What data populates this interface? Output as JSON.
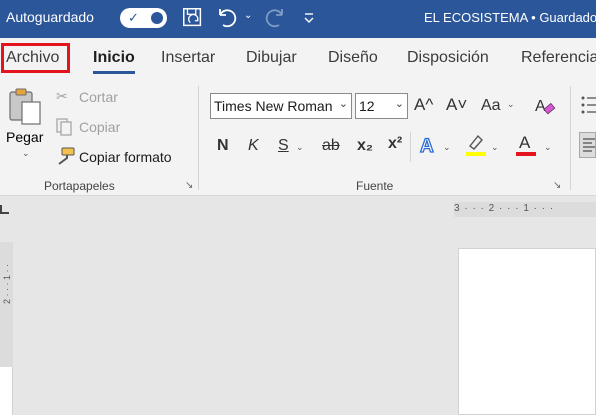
{
  "titlebar": {
    "autosave_label": "Autoguardado",
    "autosave_state": "on",
    "qat_icons": [
      "save-sync-icon",
      "undo-icon",
      "redo-icon",
      "customize-qat-icon"
    ],
    "document_title": "EL ECOSISTEMA • Guardado"
  },
  "tabs": [
    {
      "label": "Archivo",
      "highlighted": true
    },
    {
      "label": "Inicio",
      "active": true
    },
    {
      "label": "Insertar"
    },
    {
      "label": "Dibujar"
    },
    {
      "label": "Diseño"
    },
    {
      "label": "Disposición"
    },
    {
      "label": "Referencias"
    }
  ],
  "clipboard": {
    "paste_label": "Pegar",
    "cut_label": "Cortar",
    "copy_label": "Copiar",
    "format_painter_label": "Copiar formato",
    "group_label": "Portapapeles"
  },
  "font": {
    "font_name": "Times New Roman",
    "font_size": "12",
    "bold_label": "N",
    "italic_label": "K",
    "underline_label": "S",
    "strikethrough_label": "ab",
    "subscript_label": "x₂",
    "superscript_label": "x²",
    "change_case_label": "Aa",
    "grow_label": "A^",
    "shrink_label": "A˅",
    "highlight_color": "#ffff00",
    "font_color": "#e3141d",
    "group_label": "Fuente"
  },
  "ruler": {
    "top_text": "3 · · · 2 · · · 1 · · ·",
    "left_text": "2 · · · 1 · ·"
  },
  "colors": {
    "title_bar": "#2b579a",
    "highlight_box": "#e3141d"
  }
}
